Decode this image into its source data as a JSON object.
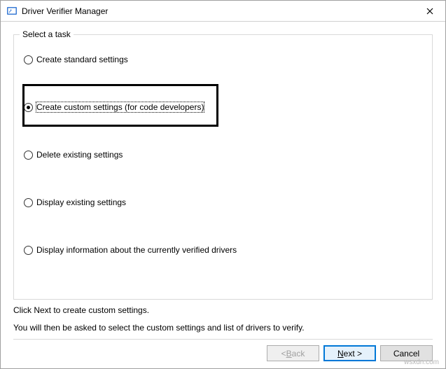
{
  "window": {
    "title": "Driver Verifier Manager"
  },
  "group": {
    "label": "Select a task"
  },
  "options": {
    "0": {
      "label": "Create standard settings",
      "checked": false
    },
    "1": {
      "label": "Create custom settings (for code developers)",
      "checked": true,
      "focused": true
    },
    "2": {
      "label": "Delete existing settings",
      "checked": false
    },
    "3": {
      "label": "Display existing settings",
      "checked": false
    },
    "4": {
      "label": "Display information about the currently verified drivers",
      "checked": false
    }
  },
  "info": {
    "line1": "Click Next to create custom settings.",
    "line2": "You will then be asked to select the custom settings and list of drivers to verify."
  },
  "buttons": {
    "back_prefix": "< ",
    "back_u": "B",
    "back_rest": "ack",
    "next_u": "N",
    "next_rest": "ext >",
    "cancel": "Cancel",
    "back_enabled": false,
    "next_enabled": true,
    "cancel_enabled": true
  },
  "watermark": "wsxdn.com"
}
